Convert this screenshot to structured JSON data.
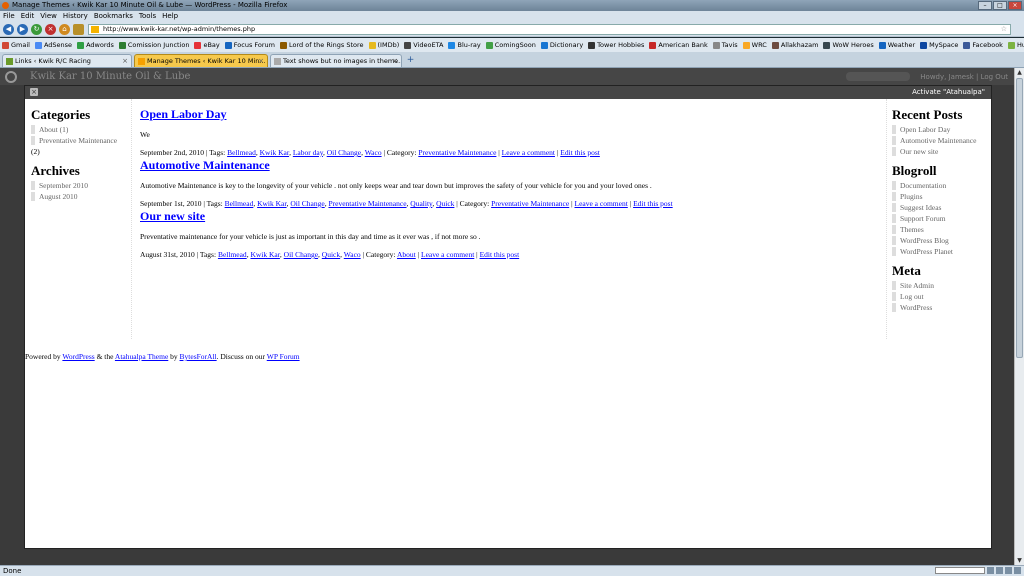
{
  "window": {
    "title": "Manage Themes ‹ Kwik Kar 10 Minute Oil & Lube — WordPress - Mozilla Firefox"
  },
  "menu": [
    "File",
    "Edit",
    "View",
    "History",
    "Bookmarks",
    "Tools",
    "Help"
  ],
  "nav": {
    "url": "http://www.kwik-kar.net/wp-admin/themes.php"
  },
  "bookmarks": [
    {
      "label": "Gmail",
      "color": "#d14836"
    },
    {
      "label": "AdSense",
      "color": "#4a8af4"
    },
    {
      "label": "Adwords",
      "color": "#2f9e44"
    },
    {
      "label": "Comission Junction",
      "color": "#2e7d32"
    },
    {
      "label": "eBay",
      "color": "#e53238"
    },
    {
      "label": "Focus Forum",
      "color": "#1565c0"
    },
    {
      "label": "Lord of the Rings Store",
      "color": "#8d5a00"
    },
    {
      "label": "(IMDb)",
      "color": "#e6b91e"
    },
    {
      "label": "VideoETA",
      "color": "#444444"
    },
    {
      "label": "Blu-ray",
      "color": "#1e88e5"
    },
    {
      "label": "ComingSoon",
      "color": "#43a047"
    },
    {
      "label": "Dictionary",
      "color": "#1976d2"
    },
    {
      "label": "Tower Hobbies",
      "color": "#333333"
    },
    {
      "label": "American Bank",
      "color": "#c62828"
    },
    {
      "label": "Tavis",
      "color": "#888888"
    },
    {
      "label": "WRC",
      "color": "#f9a825"
    },
    {
      "label": "Allakhazam",
      "color": "#6d4c41"
    },
    {
      "label": "WoW Heroes",
      "color": "#37474f"
    },
    {
      "label": "Weather",
      "color": "#1565c0"
    },
    {
      "label": "MySpace",
      "color": "#0d47a1"
    },
    {
      "label": "Facebook",
      "color": "#3b5998"
    },
    {
      "label": "Hulu",
      "color": "#7cb342"
    }
  ],
  "tabs": [
    {
      "label": "Links ‹ Kwik R/C Racing",
      "active": false
    },
    {
      "label": "Manage Themes ‹ Kwik Kar 10 Min...",
      "active": true
    },
    {
      "label": "Text shows but no images in theme...",
      "active": false
    }
  ],
  "wp": {
    "site_title": "Kwik Kar 10 Minute Oil & Lube",
    "right_links": "Howdy, Jamesk | Log Out"
  },
  "overlay": {
    "activate_label": "Activate \"Atahualpa\""
  },
  "left": {
    "categories_title": "Categories",
    "categories": [
      "About (1)",
      "Preventative Maintenance"
    ],
    "categories_count_tail": "(2)",
    "archives_title": "Archives",
    "archives": [
      "September 2010",
      "August 2010"
    ]
  },
  "posts": [
    {
      "title": "Open Labor Day",
      "body": "We",
      "date": "September 2nd, 2010",
      "tags": [
        "Bellmead",
        "Kwik Kar",
        "Labor day",
        "Oil Change",
        "Waco"
      ],
      "category": "Preventative Maintenance",
      "comment": "Leave a comment",
      "edit": "Edit this post"
    },
    {
      "title": "Automotive Maintenance",
      "body": "Automotive Maintenance is key to the longevity of your vehicle . not only keeps wear and tear down but improves the safety of your vehicle for you and your loved ones .",
      "date": "September 1st, 2010",
      "tags": [
        "Bellmead",
        "Kwik Kar",
        "Oil Change",
        "Preventative Maintenance",
        "Quality",
        "Quick"
      ],
      "category": "Preventative Maintenance",
      "comment": "Leave a comment",
      "edit": "Edit this post"
    },
    {
      "title": "Our new site",
      "body": "Preventative maintenance for your vehicle is just as important in this day and time as it ever was , if not more so .",
      "date": "August 31st, 2010",
      "tags": [
        "Bellmead",
        "Kwik Kar",
        "Oil Change",
        "Quick",
        "Waco"
      ],
      "category": "About",
      "comment": "Leave a comment",
      "edit": "Edit this post"
    }
  ],
  "meta_labels": {
    "tags": "Tags:",
    "category": "Category:"
  },
  "right": {
    "recent_title": "Recent Posts",
    "recent": [
      "Open Labor Day",
      "Automotive Maintenance",
      "Our new site"
    ],
    "blogroll_title": "Blogroll",
    "blogroll": [
      "Documentation",
      "Plugins",
      "Suggest Ideas",
      "Support Forum",
      "Themes",
      "WordPress Blog",
      "WordPress Planet"
    ],
    "meta_title": "Meta",
    "meta": [
      "Site Admin",
      "Log out",
      "WordPress"
    ]
  },
  "footer": {
    "powered": "Powered by",
    "wordpress": "WordPress",
    "and_the": "& the",
    "theme": "Atahualpa Theme",
    "by": "by",
    "author": "BytesForAll",
    "discuss": ". Discuss on our",
    "forum": "WP Forum"
  },
  "status": {
    "text": "Done"
  }
}
